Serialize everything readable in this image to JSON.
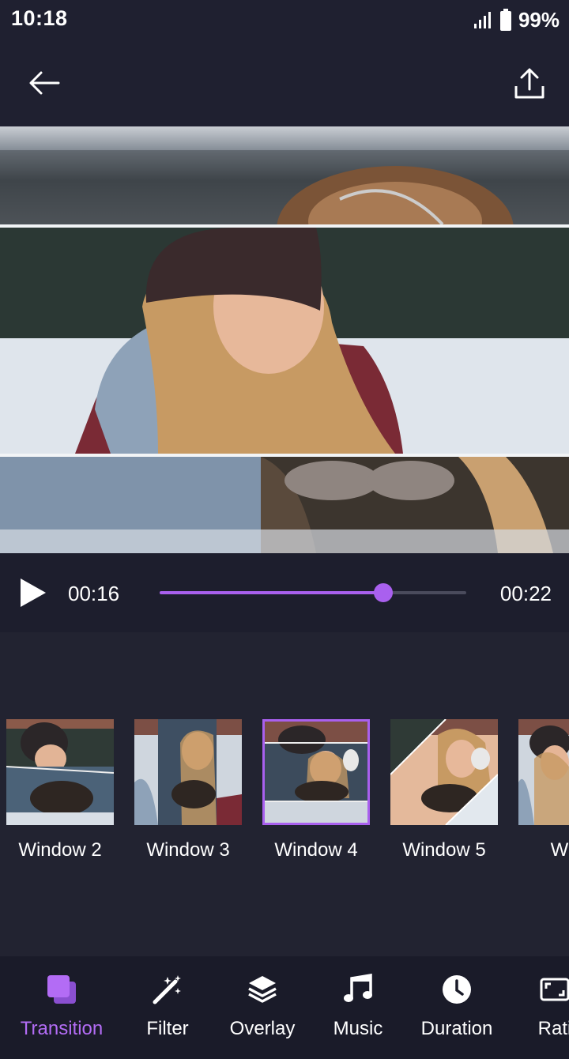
{
  "status_bar": {
    "time": "10:18",
    "battery": "99%"
  },
  "player": {
    "current_time": "00:16",
    "total_time": "00:22",
    "progress": 0.73
  },
  "transitions": {
    "items": [
      {
        "label": "Window 2",
        "selected": false
      },
      {
        "label": "Window 3",
        "selected": false
      },
      {
        "label": "Window 4",
        "selected": true
      },
      {
        "label": "Window 5",
        "selected": false
      },
      {
        "label": "Wind",
        "selected": false
      }
    ]
  },
  "bottom_nav": {
    "items": [
      {
        "label": "Transition",
        "icon": "transition-icon",
        "active": true
      },
      {
        "label": "Filter",
        "icon": "magic-wand-icon",
        "active": false
      },
      {
        "label": "Overlay",
        "icon": "layers-icon",
        "active": false
      },
      {
        "label": "Music",
        "icon": "music-note-icon",
        "active": false
      },
      {
        "label": "Duration",
        "icon": "clock-icon",
        "active": false
      },
      {
        "label": "Rati",
        "icon": "aspect-ratio-icon",
        "active": false
      }
    ]
  },
  "colors": {
    "accent": "#a960ee",
    "background": "#1f2030",
    "nav_background": "#1a1b29"
  }
}
